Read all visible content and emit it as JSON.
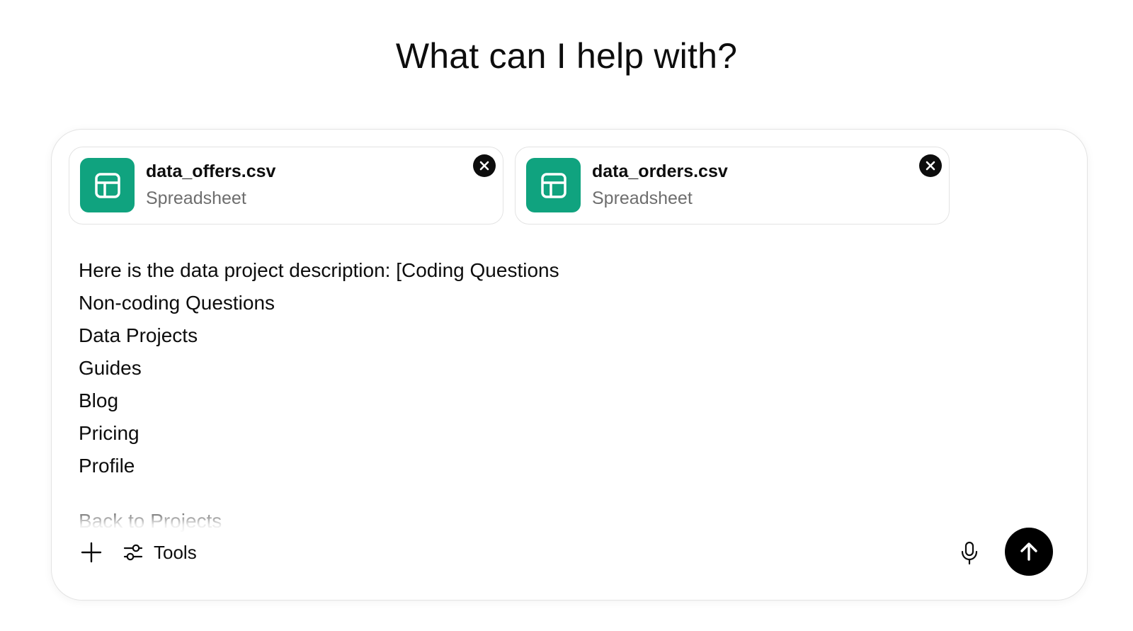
{
  "heading": "What can I help with?",
  "attachments": [
    {
      "name": "data_offers.csv",
      "type": "Spreadsheet",
      "icon": "spreadsheet-icon"
    },
    {
      "name": "data_orders.csv",
      "type": "Spreadsheet",
      "icon": "spreadsheet-icon"
    }
  ],
  "message": {
    "lines": [
      "Here is the data project description: [Coding Questions",
      "Non-coding Questions",
      "Data Projects",
      "Guides",
      "Blog",
      "Pricing",
      "Profile",
      "Back to Projects"
    ]
  },
  "toolbar": {
    "add_icon": "plus-icon",
    "tools_icon": "sliders-icon",
    "tools_label": "Tools",
    "mic_icon": "microphone-icon",
    "send_icon": "arrow-up-icon"
  },
  "colors": {
    "file_icon_bg": "#10a37f",
    "send_button_bg": "#000000",
    "border": "#e3e3e3"
  }
}
